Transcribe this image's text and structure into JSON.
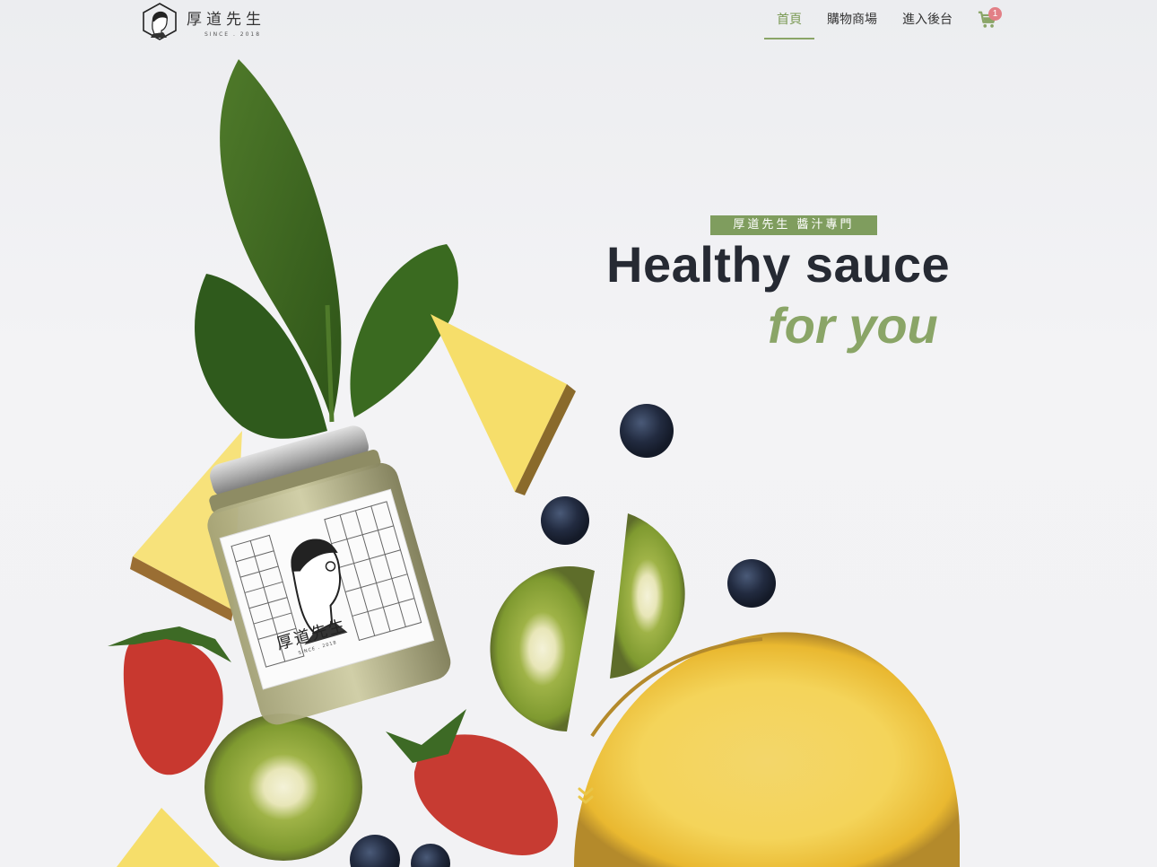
{
  "brand": {
    "name": "厚道先生",
    "since": "SINCE . 2018"
  },
  "nav": {
    "items": [
      {
        "label": "首頁",
        "active": true
      },
      {
        "label": "購物商場",
        "active": false
      },
      {
        "label": "進入後台",
        "active": false
      }
    ],
    "cart_icon": "shopping-cart-icon",
    "cart_count": "1"
  },
  "hero": {
    "tagline": "厚道先生 醬汁專門",
    "headline_line1": "Healthy sauce",
    "headline_line2": "for you",
    "scroll_icon": "double-chevron-down-icon",
    "jar_label": {
      "name": "厚道先生",
      "since": "SINCE . 2018"
    }
  },
  "colors": {
    "accent": "#8aa567",
    "badge": "#e27f86",
    "text": "#262a33"
  }
}
